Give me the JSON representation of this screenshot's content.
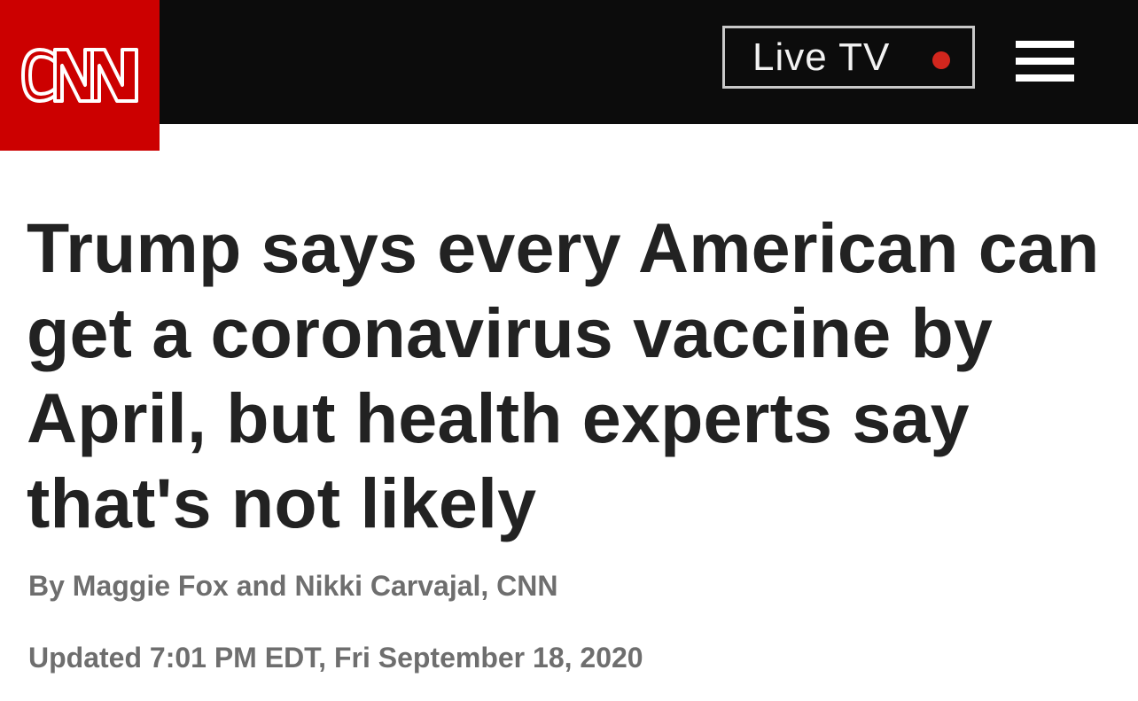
{
  "header": {
    "logo_text": "CNN",
    "logo_icon": "cnn-logo",
    "live_tv_label": "Live TV",
    "live_indicator_color": "#d2261d",
    "menu_icon": "hamburger-menu-icon",
    "brand_color": "#cc0000",
    "bar_color": "#0c0c0c"
  },
  "article": {
    "headline": "Trump says every American can get a coronavirus vaccine by April, but health experts say that's not likely",
    "byline_prefix": "By ",
    "author_1": "Maggie Fox",
    "byline_joiner": " and ",
    "author_2": "Nikki Carvajal",
    "byline_suffix": ", CNN",
    "updated": "Updated 7:01 PM EDT, Fri September 18, 2020"
  }
}
